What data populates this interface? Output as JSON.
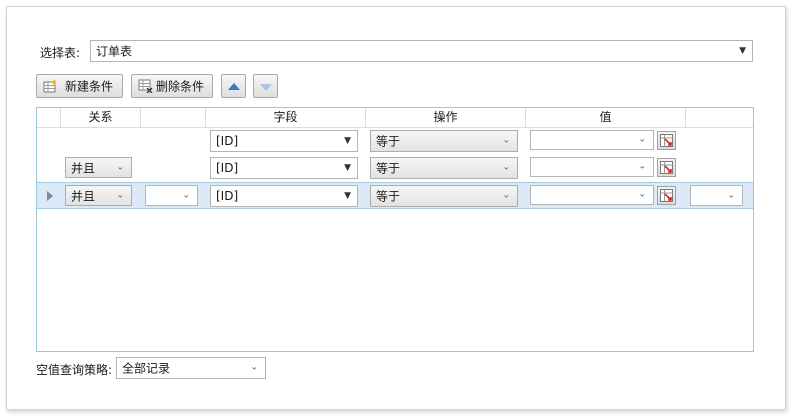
{
  "table_select": {
    "label": "选择表:",
    "value": "订单表"
  },
  "toolbar": {
    "new_condition": "新建条件",
    "delete_condition": "删除条件",
    "move_up": "move-up",
    "move_down": "move-down"
  },
  "grid": {
    "columns": {
      "relation": "关系",
      "field": "字段",
      "operation": "操作",
      "value": "值"
    },
    "rows": [
      {
        "relation": "",
        "field": "[ID]",
        "operation": "等于",
        "value": ""
      },
      {
        "relation": "并且",
        "field": "[ID]",
        "operation": "等于",
        "value": ""
      },
      {
        "relation": "并且",
        "bracket": "",
        "field": "[ID]",
        "operation": "等于",
        "value": "",
        "extra": ""
      }
    ]
  },
  "null_policy": {
    "label": "空值查询策略:",
    "value": "全部记录"
  },
  "colors": {
    "accent": "#3a78c3",
    "selected_row": "#dbeaf6",
    "grid_border": "#9fc5dd"
  }
}
